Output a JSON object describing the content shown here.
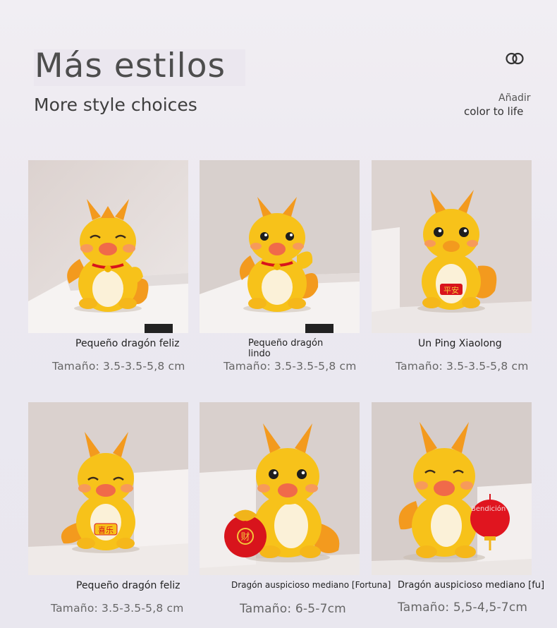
{
  "header": {
    "title": "Más estilos",
    "subtitle": "More style choices",
    "tagline_line1": "Añadir",
    "tagline_line2": "color to life",
    "logo_icon": "interlocked-rings-icon"
  },
  "products": [
    {
      "name": "Pequeño dragón feliz",
      "size": "Tamaño: 3.5-3.5-5,8 cm"
    },
    {
      "name": "Pequeño dragón lindo",
      "size": "Tamaño: 3.5-3.5-5,8 cm"
    },
    {
      "name": "Un Ping Xiaolong",
      "size": "Tamaño: 3.5-3.5-5,8 cm"
    },
    {
      "name": "Pequeño dragón feliz",
      "size": "Tamaño: 3.5-3.5-5,8 cm"
    },
    {
      "name": "Dragón auspicioso mediano [Fortuna]",
      "size": "Tamaño: 6-5-7cm"
    },
    {
      "name": "Dragón auspicioso mediano [fu]",
      "size": "Tamaño: 5,5-4,5-7cm",
      "lantern_text": "Bendición"
    }
  ],
  "colors": {
    "dragon_body": "#f7c21a",
    "dragon_accent": "#f39a1e",
    "bag_red": "#d8141c",
    "background": "#ece9f0"
  }
}
